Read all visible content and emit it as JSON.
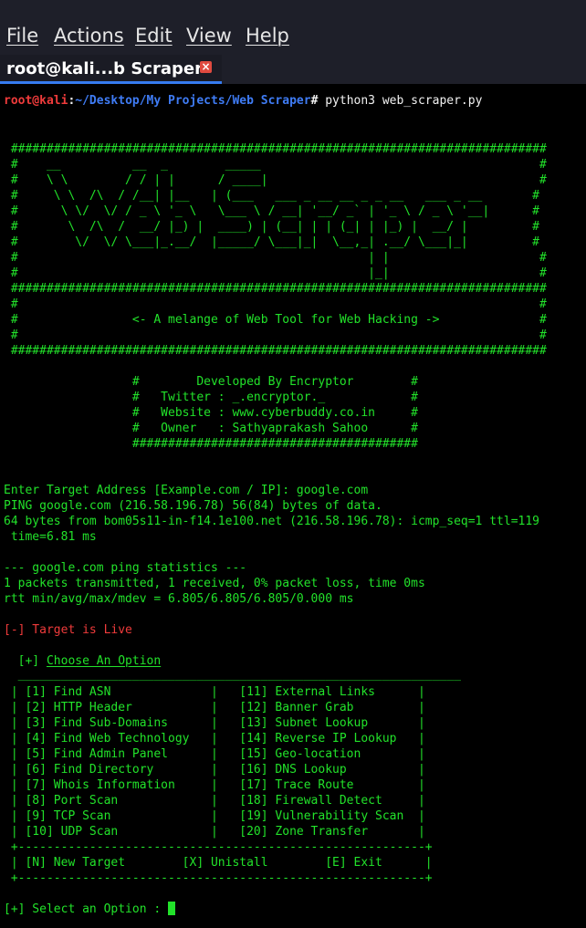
{
  "menubar": {
    "items": [
      "File",
      "Actions",
      "Edit",
      "View",
      "Help"
    ]
  },
  "tab": {
    "title": "root@kali...b Scraper",
    "close_icon": "close-icon"
  },
  "terminal": {
    "prompt": {
      "user": "root@kali",
      "colon": ":",
      "path": "~/Desktop/My Projects/Web Scraper",
      "hash": "#",
      "command": " python3 web_scraper.py"
    },
    "banner": [
      " ###########################################################################",
      " #    __          __  _        _____                                       #",
      " #    \\ \\        / / | |      / ____|                                      #",
      " #     \\ \\  /\\  / /__| |__   | (___   ___ _ __ __ _ _ __   ___ _ __       #",
      " #      \\ \\/  \\/ / _ \\ '_ \\   \\___ \\ / __| '__/ _` | '_ \\ / _ \\ '__|      #",
      " #       \\  /\\  /  __/ |_) |  ____) | (__| | | (_| | |_) |  __/ |         #",
      " #        \\/  \\/ \\___|_.__/  |_____/ \\___|_|  \\__,_| .__/ \\___|_|         #",
      " #                                                 | |                     #",
      " #                                                 |_|                     #",
      " ###########################################################################",
      " #                                                                         #",
      " #                <- A melange of Web Tool for Web Hacking ->              #",
      " #                                                                         #",
      " ###########################################################################"
    ],
    "credits": [
      "                  #        Developed By Encryptor        #",
      "                  #   Twitter : _.encryptor._            #",
      "                  #   Website : www.cyberbuddy.co.in     #",
      "                  #   Owner   : Sathyaprakash Sahoo      #",
      "                  ########################################"
    ],
    "target_prompt": "Enter Target Address [Example.com / IP]: google.com",
    "ping_output": [
      "PING google.com (216.58.196.78) 56(84) bytes of data.",
      "64 bytes from bom05s11-in-f14.1e100.net (216.58.196.78): icmp_seq=1 ttl=119",
      " time=6.81 ms",
      "",
      "--- google.com ping statistics ---",
      "1 packets transmitted, 1 received, 0% packet loss, time 0ms",
      "rtt min/avg/max/mdev = 6.805/6.805/6.805/0.000 ms"
    ],
    "status_live": "[-] Target is Live",
    "choose_prefix": "  [+] ",
    "choose_label": "Choose An Option",
    "menu_lines": [
      "  ______________________________________________________________",
      " | [1] Find ASN              |   [11] External Links      |",
      " | [2] HTTP Header           |   [12] Banner Grab         |",
      " | [3] Find Sub-Domains      |   [13] Subnet Lookup       |",
      " | [4] Find Web Technology   |   [14] Reverse IP Lookup   |",
      " | [5] Find Admin Panel      |   [15] Geo-location        |",
      " | [6] Find Directory        |   [16] DNS Lookup          |",
      " | [7] Whois Information     |   [17] Trace Route         |",
      " | [8] Port Scan             |   [18] Firewall Detect     |",
      " | [9] TCP Scan              |   [19] Vulnerability Scan  |",
      " | [10] UDP Scan             |   [20] Zone Transfer       |",
      " +---------------------------------------------------------+",
      " | [N] New Target        [X] Unistall        [E] Exit      |",
      " +---------------------------------------------------------+"
    ],
    "select_prompt": "[+] Select an Option : "
  }
}
